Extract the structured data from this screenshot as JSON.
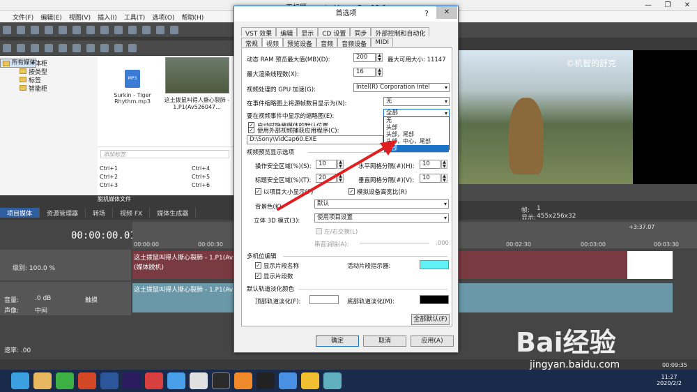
{
  "app": {
    "title": "无标题.veg * - Vegas Pro 13.0",
    "menu": [
      "文件(F)",
      "编辑(E)",
      "视图(V)",
      "插入(I)",
      "工具(T)",
      "选项(O)",
      "帮助(H)"
    ],
    "explorer": {
      "items": [
        "所有媒体",
        "媒体柜",
        "按类型",
        "标签",
        "智能柜"
      ]
    },
    "media": {
      "item1_label": "Surkin - Tiger Rhythm.mp3",
      "item1_icon": "MP3",
      "item2_label": "这土拨鼠叫得人撕心裂肺 - 1.P1(Av526047...",
      "tag_placeholder": "添加标签",
      "shortcuts": [
        "Ctrl+1",
        "Ctrl+2",
        "Ctrl+3",
        "Ctrl+4",
        "Ctrl+5",
        "Ctrl+6"
      ],
      "status": "脱机媒体文件"
    },
    "bottom_tabs": [
      "项目媒体",
      "资源管理器",
      "转场",
      "视频 FX",
      "媒体生成器"
    ],
    "preview": {
      "watermark": "©机智的舒克",
      "frame_label": "帧:",
      "frame_value": "1",
      "display_label": "显示:",
      "display_value": "455x256x32"
    },
    "timeline": {
      "time": "00:00:00.01",
      "ticks": [
        "00:00:00",
        "00:00:30",
        "00:02:30",
        "00:03:00",
        "00:03:30"
      ],
      "end_badge": "+3:37.07",
      "track1": {
        "level_label": "级别: 100.0 %",
        "clip_label": "这土拨鼠叫得人撕心裂肺 - 1.P1(Av526047",
        "clip_sub": "(媒体脱机)"
      },
      "track2": {
        "vol_label": "音量:",
        "vol_value": ".0 dB",
        "pan_label": "声像:",
        "pan_value": "中间",
        "touch": "触摸",
        "clip_label": "这土拨鼠叫得人撕心裂肺 - 1.P1(Av526047"
      },
      "speed": "速率: .00",
      "end_time": "00:09:35"
    },
    "clock": {
      "time": "11:27",
      "date": "2020/2/2"
    },
    "watermark_site": "jingyan.baidu.com",
    "watermark_brand": "Bai经验"
  },
  "dialog": {
    "title": "首选项",
    "help": "?",
    "close": "✕",
    "tabs_row1": [
      "VST 效果",
      "编辑",
      "显示",
      "CD 设置",
      "同步",
      "外部控制和自动化"
    ],
    "tabs_row2": [
      "常规",
      "视频",
      "预览设备",
      "音频",
      "音频设备",
      "MIDI"
    ],
    "ram_label": "动态 RAM 预览最大值(MB)(D):",
    "ram_value": "200",
    "ram_max_label": "最大可用大小: 11147",
    "threads_label": "最大渲染线程数(X):",
    "threads_value": "16",
    "gpu_label": "视频处理的 GPU 加速(G):",
    "gpu_value": "Intel(R) Corporation Intel",
    "frames_label": "在事件缩略图上将源帧数目显示为(N):",
    "frames_value": "无",
    "thumbs_label": "要在视频事件中显示的缩略图(E):",
    "thumbs_value": "全部",
    "thumbs_options": [
      "无",
      "头部",
      "头部，尾部",
      "头部，中心，尾部",
      "全部"
    ],
    "deint_label": "启动时隐藏媒体的默认位置",
    "extapp_label": "使用外部视频捕获应用程序(C):",
    "extapp_path": "D:\\Sony\\VidCap60.EXE",
    "section_preview": "视频预览显示选项",
    "safe_action_label": "操作安全区域(%)(S):",
    "safe_action_value": "10",
    "safe_title_label": "标题安全区域(%)(T):",
    "safe_title_value": "20",
    "hgrid_label": "水平网格分隔(#)(H):",
    "hgrid_value": "10",
    "vgrid_label": "垂直网格分隔(#)(V):",
    "vgrid_value": "10",
    "aspect_label": "以项目大小显示(P)",
    "hilite_label": "模拟设备高宽比(R)",
    "bg_label": "背景色(K):",
    "bg_value": "默认",
    "stereo_label": "立体 3D 模式(3):",
    "stereo_value": "使用项目设置",
    "swap_label": "左/右交换(L)",
    "crosstalk_label": "串音消除(A):",
    "crosstalk_value": ".000",
    "section_multicam": "多机位编辑",
    "show_names_label": "显示片段名称",
    "show_numbers_label": "显示片段数",
    "active_indicator_label": "活动片段指示器:",
    "section_fade": "默认轨道淡化颜色",
    "top_fade_label": "顶部轨道淡化(F):",
    "bottom_fade_label": "底部轨道淡化(M):",
    "all_defaults": "全部默认(F)",
    "ok": "确定",
    "cancel": "取消",
    "apply": "应用(A)",
    "colors": {
      "indicator": "#5ef2f5",
      "top_fade": "#ffffff",
      "bottom_fade": "#000000"
    }
  }
}
